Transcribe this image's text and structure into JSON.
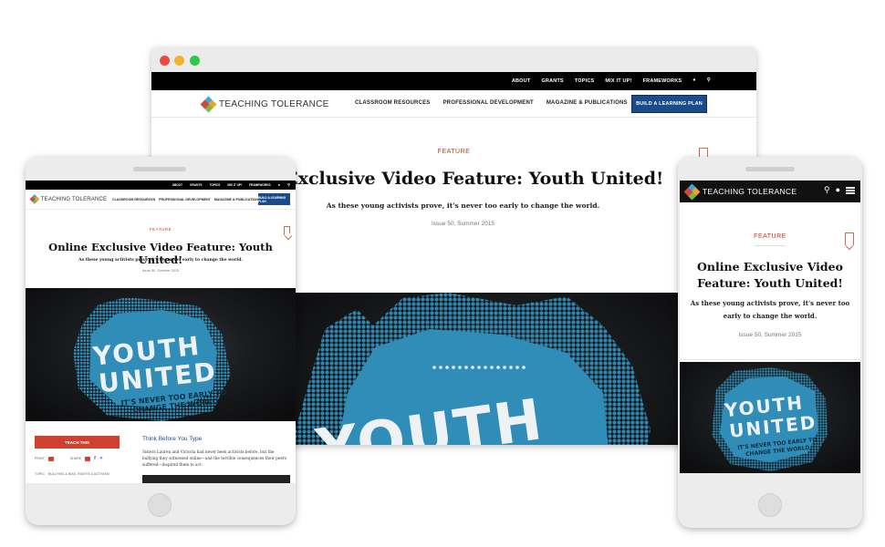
{
  "site": {
    "logo_text": "TEACHING TOLERANCE",
    "top_links": [
      "ABOUT",
      "GRANTS",
      "TOPICS",
      "MIX IT UP!",
      "FRAMEWORKS"
    ],
    "main_menu": [
      "CLASSROOM RESOURCES",
      "PROFESSIONAL DEVELOPMENT",
      "MAGAZINE & PUBLICATIONS"
    ],
    "cta": "BUILD A LEARNING PLAN"
  },
  "article": {
    "label": "FEATURE",
    "title": "Online Exclusive Video Feature: Youth United!",
    "title_cropped": "ne Exclusive Video Feature: Youth United!",
    "subtitle": "As these young activists prove, it's never too early to change the world.",
    "issue": "Issue 50, Summer 2015"
  },
  "hero": {
    "line1": "YOUTH",
    "line2": "UNITED",
    "tagline1": "IT'S NEVER TOO EARLY TO",
    "tagline2": "CHANGE THE WORLD"
  },
  "tablet": {
    "teach_this": "TEACH THIS",
    "print_label": "PRINT",
    "share_label": "SHARE",
    "topic_label": "TOPIC",
    "topics": "BULLYING & BIAS, RIGHTS & ACTIVISM",
    "article_heading": "Think Before You Type",
    "article_text": "Sisters Lauren and Victoria had never been activists before, but the bullying they witnessed online—and the terrible consequences their peers suffered—inspired them to act."
  },
  "colors": {
    "accent_red": "#c0392b",
    "brand_blue": "#1a4b8b",
    "hero_blue": "#2f8db8"
  }
}
